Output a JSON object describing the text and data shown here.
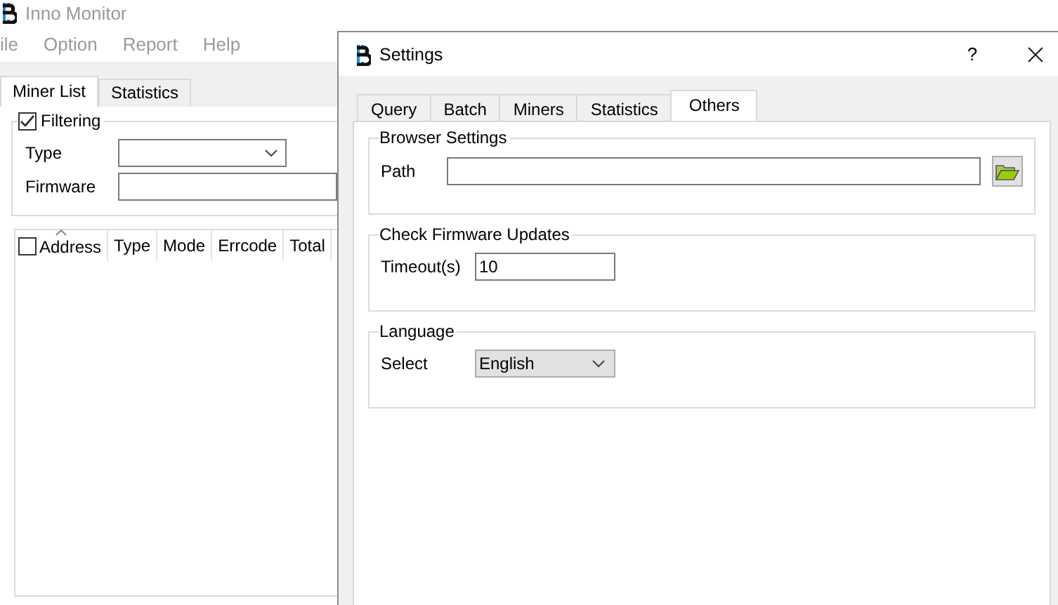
{
  "main_window": {
    "title": "Inno Monitor",
    "menu": [
      "ile",
      "Option",
      "Report",
      "Help"
    ],
    "tabs": [
      {
        "label": "Miner List",
        "selected": true
      },
      {
        "label": "Statistics",
        "selected": false
      }
    ],
    "filter": {
      "label": "Filtering",
      "checked": true,
      "fields": [
        {
          "label": "Type",
          "kind": "dropdown"
        },
        {
          "label": "Firmware",
          "kind": "text"
        }
      ]
    },
    "table": {
      "select_all_checked": false,
      "columns": [
        "Address",
        "Type",
        "Mode",
        "Errcode",
        "Total"
      ]
    }
  },
  "dialog": {
    "title": "Settings",
    "help": "?",
    "tabs": [
      {
        "label": "Query",
        "selected": false
      },
      {
        "label": "Batch",
        "selected": false
      },
      {
        "label": "Miners",
        "selected": false
      },
      {
        "label": "Statistics",
        "selected": false
      },
      {
        "label": "Others",
        "selected": true
      }
    ],
    "groups": [
      {
        "title": "Browser Settings",
        "kind": "path",
        "label": "Path"
      },
      {
        "title": "Check Firmware Updates",
        "kind": "text",
        "label": "Timeout(s)",
        "value": "10"
      },
      {
        "title": "Language",
        "kind": "dropdown",
        "label": "Select",
        "value": "English"
      }
    ]
  }
}
